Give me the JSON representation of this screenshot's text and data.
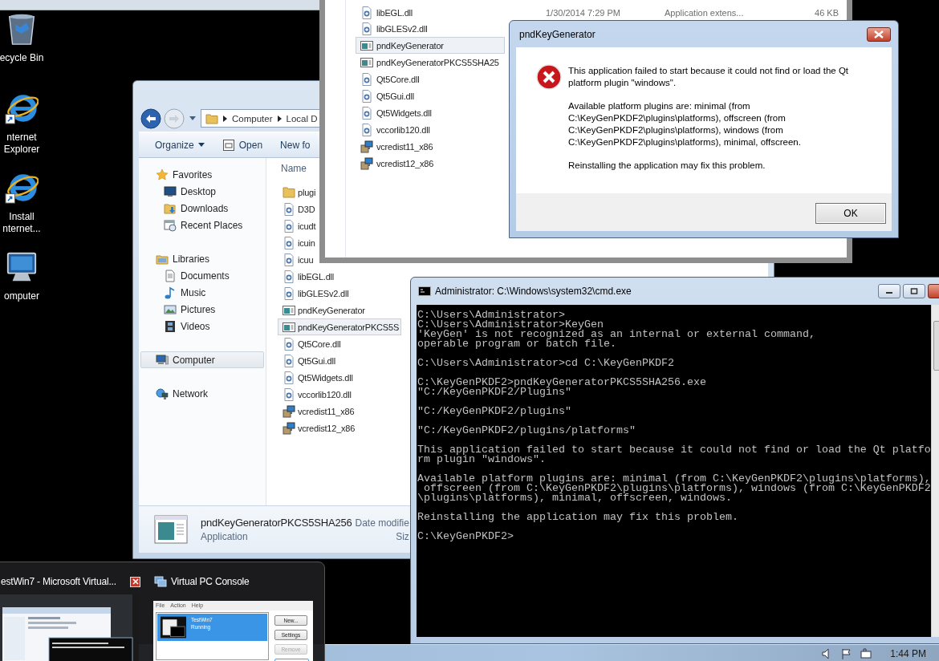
{
  "desktop_icons": [
    {
      "kind": "recycle_bin",
      "label_lines": [
        "ecycle Bin"
      ]
    },
    {
      "kind": "browser",
      "label_lines": [
        "nternet",
        "Explorer"
      ]
    },
    {
      "kind": "browser",
      "label_lines": [
        "Install",
        "nternet..."
      ]
    },
    {
      "kind": "computer",
      "label_lines": [
        "omputer"
      ]
    }
  ],
  "explorer": {
    "address": [
      "Computer",
      "Local D"
    ],
    "toolbar": [
      "Organize",
      "Open",
      "New fo"
    ],
    "sidebar": [
      {
        "label": "Favorites",
        "kind": "star",
        "selected": false,
        "children": [
          {
            "label": "Desktop",
            "kind": "desktop",
            "selected": false
          },
          {
            "label": "Downloads",
            "kind": "downloads",
            "selected": false
          },
          {
            "label": "Recent Places",
            "kind": "recent",
            "selected": false
          }
        ]
      },
      {
        "label": "Libraries",
        "kind": "libraries",
        "selected": false,
        "children": [
          {
            "label": "Documents",
            "kind": "documents",
            "selected": false
          },
          {
            "label": "Music",
            "kind": "music",
            "selected": false
          },
          {
            "label": "Pictures",
            "kind": "pictures",
            "selected": false
          },
          {
            "label": "Videos",
            "kind": "videos",
            "selected": false
          }
        ]
      },
      {
        "label": "Computer",
        "kind": "computer",
        "selected": true
      },
      {
        "label": "Network",
        "kind": "network",
        "selected": false
      }
    ],
    "column_header": "Name",
    "files": [
      {
        "name": "plugi",
        "kind": "folder",
        "selected": false
      },
      {
        "name": "D3D",
        "kind": "dll",
        "selected": false
      },
      {
        "name": "icudt",
        "kind": "dll",
        "selected": false
      },
      {
        "name": "icuin",
        "kind": "dll",
        "selected": false
      },
      {
        "name": "icuu",
        "kind": "dll",
        "selected": false
      },
      {
        "name": "libEGL.dll",
        "kind": "dll",
        "selected": false
      },
      {
        "name": "libGLESv2.dll",
        "kind": "dll",
        "selected": false
      },
      {
        "name": "pndKeyGenerator",
        "kind": "app",
        "selected": false
      },
      {
        "name": "pndKeyGeneratorPKCS5S",
        "kind": "app",
        "selected": true
      },
      {
        "name": "Qt5Core.dll",
        "kind": "dll",
        "selected": false
      },
      {
        "name": "Qt5Gui.dll",
        "kind": "dll",
        "selected": false
      },
      {
        "name": "Qt5Widgets.dll",
        "kind": "dll",
        "selected": false
      },
      {
        "name": "vccorlib120.dll",
        "kind": "dll",
        "selected": false
      },
      {
        "name": "vcredist11_x86",
        "kind": "installer",
        "selected": false
      },
      {
        "name": "vcredist12_x86",
        "kind": "installer",
        "selected": false
      }
    ],
    "details": {
      "name": "pndKeyGeneratorPKCS5SHA256",
      "type": "Application",
      "date_label": "Date modifie",
      "size_label": "Siz"
    }
  },
  "back_explorer": {
    "files": [
      {
        "name": "libEGL.dll",
        "kind": "dll",
        "selected": false,
        "date": "1/30/2014 7:29 PM",
        "type": "Application extens...",
        "size": "46 KB"
      },
      {
        "name": "libGLESv2.dll",
        "kind": "dll",
        "selected": false
      },
      {
        "name": "pndKeyGenerator",
        "kind": "app",
        "selected": true
      },
      {
        "name": "pndKeyGeneratorPKCS5SHA25",
        "kind": "app",
        "selected": false
      },
      {
        "name": "Qt5Core.dll",
        "kind": "dll",
        "selected": false
      },
      {
        "name": "Qt5Gui.dll",
        "kind": "dll",
        "selected": false
      },
      {
        "name": "Qt5Widgets.dll",
        "kind": "dll",
        "selected": false
      },
      {
        "name": "vccorlib120.dll",
        "kind": "dll",
        "selected": false
      },
      {
        "name": "vcredist11_x86",
        "kind": "installer",
        "selected": false
      },
      {
        "name": "vcredist12_x86",
        "kind": "installer",
        "selected": false
      }
    ]
  },
  "dialog": {
    "title": "pndKeyGenerator",
    "paragraphs": [
      [
        "This application failed to start because it could not find or load the Qt",
        "platform plugin \"windows\"."
      ],
      [
        "Available platform plugins are: minimal (from",
        "C:\\KeyGenPKDF2\\plugins\\platforms), offscreen (from",
        "C:\\KeyGenPKDF2\\plugins\\platforms), windows (from",
        "C:\\KeyGenPKDF2\\plugins\\platforms), minimal, offscreen."
      ],
      [
        "Reinstalling the application may fix this problem."
      ]
    ],
    "button": "OK"
  },
  "cmd": {
    "title": "Administrator: C:\\Windows\\system32\\cmd.exe",
    "blocks": [
      [
        "C:\\Users\\Administrator>",
        "C:\\Users\\Administrator>KeyGen",
        "'KeyGen' is not recognized as an internal or external command,",
        "operable program or batch file."
      ],
      [
        "C:\\Users\\Administrator>cd C:\\KeyGenPKDF2"
      ],
      [
        "C:\\KeyGenPKDF2>pndKeyGeneratorPKCS5SHA256.exe",
        "\"C:/KeyGenPKDF2/Plugins\""
      ],
      [
        "\"C:/KeyGenPKDF2/plugins\""
      ],
      [
        "\"C:/KeyGenPKDF2/plugins/platforms\""
      ],
      [
        "This application failed to start because it could not find or load the Qt platfo",
        "rm plugin \"windows\"."
      ],
      [
        "Available platform plugins are: minimal (from C:\\KeyGenPKDF2\\plugins\\platforms),",
        " offscreen (from C:\\KeyGenPKDF2\\plugins\\platforms), windows (from C:\\KeyGenPKDF2",
        "\\plugins\\platforms), minimal, offscreen, windows."
      ],
      [
        "Reinstalling the application may fix this problem."
      ],
      [
        "C:\\KeyGenPKDF2>"
      ]
    ]
  },
  "preview": {
    "vm_window": {
      "title": "estWin7 - Microsoft Virtual..."
    },
    "console_window": {
      "title": "Virtual PC Console",
      "menu": [
        "File",
        "Action",
        "Help"
      ],
      "machines": [
        {
          "name": "TestWin7",
          "status": "Running",
          "selected": true
        }
      ],
      "buttons": [
        {
          "label": "New...",
          "disabled": false
        },
        {
          "label": "Settings",
          "disabled": false
        },
        {
          "label": "Remove",
          "disabled": true
        }
      ]
    }
  },
  "taskbar": {
    "time": "1:44 PM"
  }
}
